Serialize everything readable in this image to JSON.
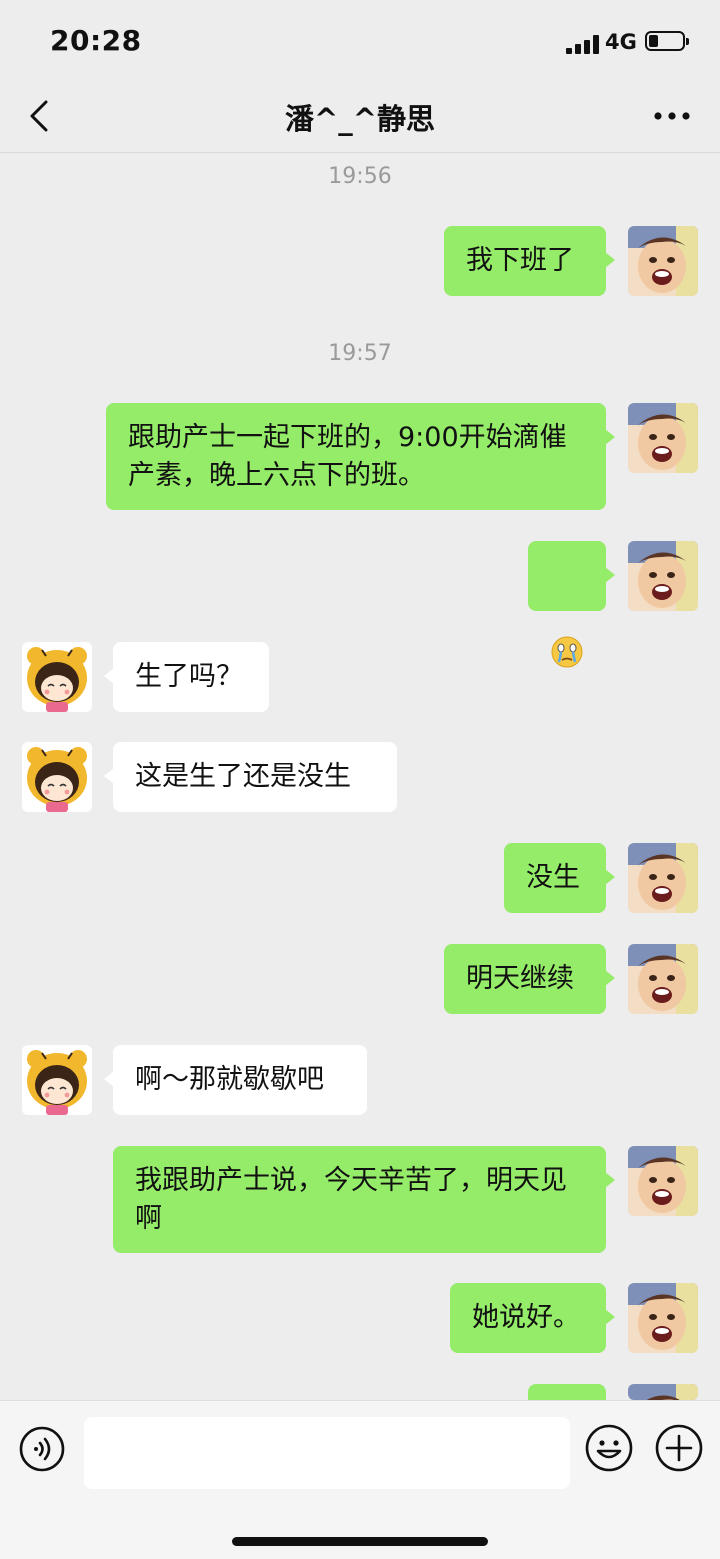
{
  "status": {
    "time": "20:28",
    "network": "4G",
    "battery_level": 0.28
  },
  "header": {
    "title": "潘^_^静思"
  },
  "timestamps": [
    "19:56",
    "19:57"
  ],
  "messages": [
    {
      "side": "out",
      "text": "我下班了"
    },
    {
      "side": "out",
      "text": "跟助产士一起下班的，9:00开始滴催产素，晚上六点下的班。"
    },
    {
      "side": "out",
      "type": "emoji",
      "icon": "crying-face-emoji"
    },
    {
      "side": "in",
      "text": "生了吗？"
    },
    {
      "side": "in",
      "text": "这是生了还是没生"
    },
    {
      "side": "out",
      "text": "没生"
    },
    {
      "side": "out",
      "text": "明天继续"
    },
    {
      "side": "in",
      "text": "啊～那就歇歇吧"
    },
    {
      "side": "out",
      "text": "我跟助产士说，今天辛苦了，明天见啊"
    },
    {
      "side": "out",
      "text": "她说好。"
    }
  ],
  "input": {
    "value": ""
  },
  "icons": {
    "back": "chevron-left-icon",
    "more": "ellipsis-icon",
    "voice": "voice-icon",
    "emoji": "emoji-icon",
    "plus": "plus-icon"
  },
  "colors": {
    "outgoing_bubble": "#95ec69",
    "incoming_bubble": "#ffffff",
    "background": "#ededed"
  }
}
